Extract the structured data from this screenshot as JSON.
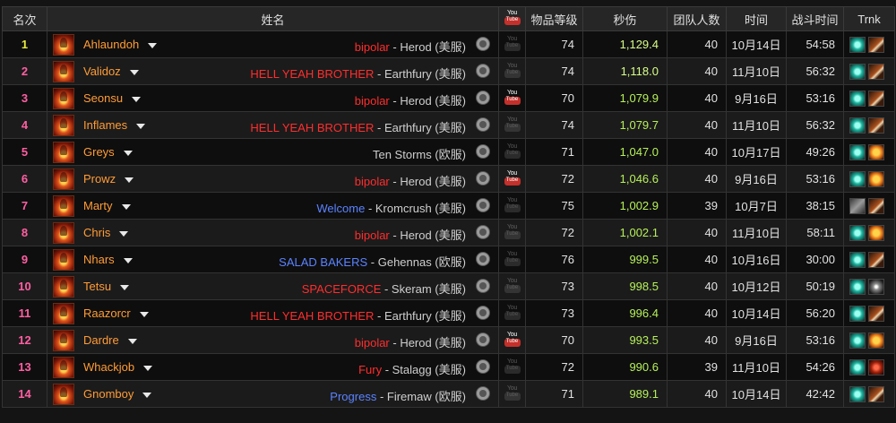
{
  "headers": {
    "rank": "名次",
    "name": "姓名",
    "youtube": "YouTube",
    "ilvl": "物品等级",
    "dps": "秒伤",
    "size": "团队人数",
    "date": "时间",
    "duration": "战斗时间",
    "trinkets": "Trnk"
  },
  "rows": [
    {
      "rank": "1",
      "name": "Ahlaundoh",
      "guild": "bipolar",
      "guild_color": "red",
      "server": " - Herod (美服)",
      "video": false,
      "ilvl": "74",
      "dps": "1,129.4",
      "size": "40",
      "date": "10月14日",
      "duration": "54:58",
      "trinkets": [
        "teal-icon",
        "claw-icon"
      ]
    },
    {
      "rank": "2",
      "name": "Validoz",
      "guild": "HELL YEAH BROTHER",
      "guild_color": "red",
      "server": " - Earthfury (美服)",
      "video": false,
      "ilvl": "74",
      "dps": "1,118.0",
      "size": "40",
      "date": "11月10日",
      "duration": "56:32",
      "trinkets": [
        "teal-icon",
        "claw-icon"
      ]
    },
    {
      "rank": "3",
      "name": "Seonsu",
      "guild": "bipolar",
      "guild_color": "red",
      "server": " - Herod (美服)",
      "video": true,
      "ilvl": "70",
      "dps": "1,079.9",
      "size": "40",
      "date": "9月16日",
      "duration": "53:16",
      "trinkets": [
        "teal-icon",
        "claw-icon"
      ]
    },
    {
      "rank": "4",
      "name": "Inflames",
      "guild": "HELL YEAH BROTHER",
      "guild_color": "red",
      "server": " - Earthfury (美服)",
      "video": false,
      "ilvl": "74",
      "dps": "1,079.7",
      "size": "40",
      "date": "11月10日",
      "duration": "56:32",
      "trinkets": [
        "teal-icon",
        "claw-icon"
      ]
    },
    {
      "rank": "5",
      "name": "Greys",
      "guild": "",
      "guild_color": "none",
      "server": "Ten Storms (欧服)",
      "video": false,
      "ilvl": "71",
      "dps": "1,047.0",
      "size": "40",
      "date": "10月17日",
      "duration": "49:26",
      "trinkets": [
        "teal-icon",
        "pumpkin-icon"
      ]
    },
    {
      "rank": "6",
      "name": "Prowz",
      "guild": "bipolar",
      "guild_color": "red",
      "server": " - Herod (美服)",
      "video": true,
      "ilvl": "72",
      "dps": "1,046.6",
      "size": "40",
      "date": "9月16日",
      "duration": "53:16",
      "trinkets": [
        "teal-icon",
        "pumpkin-icon"
      ]
    },
    {
      "rank": "7",
      "name": "Marty",
      "guild": "Welcome",
      "guild_color": "blue",
      "server": " - Kromcrush (美服)",
      "video": false,
      "ilvl": "75",
      "dps": "1,002.9",
      "size": "39",
      "date": "10月7日",
      "duration": "38:15",
      "trinkets": [
        "gray-icon",
        "claw-icon"
      ]
    },
    {
      "rank": "8",
      "name": "Chris",
      "guild": "bipolar",
      "guild_color": "red",
      "server": " - Herod (美服)",
      "video": false,
      "ilvl": "72",
      "dps": "1,002.1",
      "size": "40",
      "date": "11月10日",
      "duration": "58:11",
      "trinkets": [
        "teal-icon",
        "pumpkin-icon"
      ]
    },
    {
      "rank": "9",
      "name": "Nhars",
      "guild": "SALAD BAKERS",
      "guild_color": "blue",
      "server": " - Gehennas (欧服)",
      "video": false,
      "ilvl": "76",
      "dps": "999.5",
      "size": "40",
      "date": "10月16日",
      "duration": "30:00",
      "trinkets": [
        "teal-icon",
        "claw-icon"
      ]
    },
    {
      "rank": "10",
      "name": "Tetsu",
      "guild": "SPACEFORCE",
      "guild_color": "red",
      "server": " - Skeram (美服)",
      "video": false,
      "ilvl": "73",
      "dps": "998.5",
      "size": "40",
      "date": "10月12日",
      "duration": "50:19",
      "trinkets": [
        "teal-icon",
        "spark-icon"
      ]
    },
    {
      "rank": "11",
      "name": "Raazorcr",
      "guild": "HELL YEAH BROTHER",
      "guild_color": "red",
      "server": " - Earthfury (美服)",
      "video": false,
      "ilvl": "73",
      "dps": "996.4",
      "size": "40",
      "date": "10月14日",
      "duration": "56:20",
      "trinkets": [
        "teal-icon",
        "claw-icon"
      ]
    },
    {
      "rank": "12",
      "name": "Dardre",
      "guild": "bipolar",
      "guild_color": "red",
      "server": " - Herod (美服)",
      "video": true,
      "ilvl": "70",
      "dps": "993.5",
      "size": "40",
      "date": "9月16日",
      "duration": "53:16",
      "trinkets": [
        "teal-icon",
        "pumpkin-icon"
      ]
    },
    {
      "rank": "13",
      "name": "Whackjob",
      "guild": "Fury",
      "guild_color": "red",
      "server": " - Stalagg (美服)",
      "video": false,
      "ilvl": "72",
      "dps": "990.6",
      "size": "39",
      "date": "11月10日",
      "duration": "54:26",
      "trinkets": [
        "teal-icon",
        "red-icon"
      ]
    },
    {
      "rank": "14",
      "name": "Gnomboy",
      "guild": "Progress",
      "guild_color": "blue",
      "server": " - Firemaw (欧服)",
      "video": false,
      "ilvl": "71",
      "dps": "989.1",
      "size": "40",
      "date": "10月14日",
      "duration": "42:42",
      "trinkets": [
        "teal-icon",
        "claw-icon"
      ]
    }
  ],
  "youtube_glyph": {
    "top": "You",
    "bottom": "Tube"
  }
}
